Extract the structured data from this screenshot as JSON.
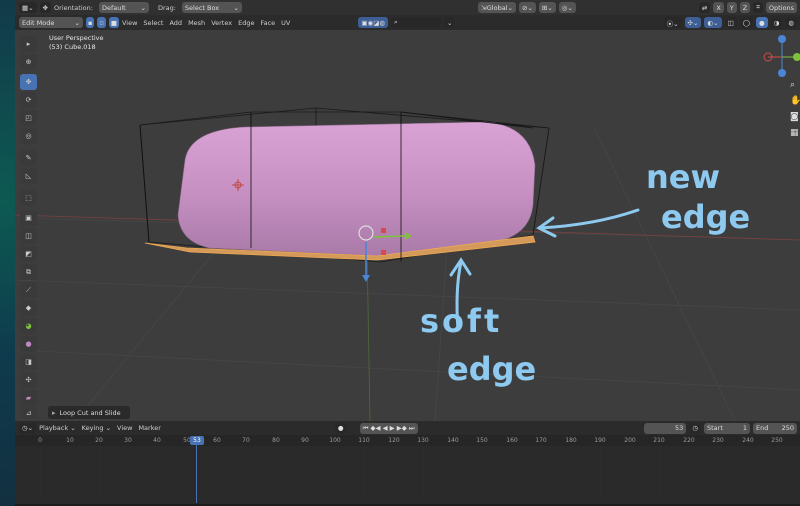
{
  "header": {
    "orientation_label": "Orientation:",
    "orientation_value": "Default",
    "drag_label": "Drag:",
    "drag_value": "Select Box",
    "transform_space": "Global",
    "options_label": "Options"
  },
  "menu": {
    "mode": "Edit Mode",
    "items": [
      "View",
      "Select",
      "Add",
      "Mesh",
      "Vertex",
      "Edge",
      "Face",
      "UV"
    ]
  },
  "viewport": {
    "perspective": "User Perspective",
    "object_name": "(53) Cube.018",
    "operator_panel": "Loop Cut and Slide"
  },
  "annotations": {
    "new_edge_line1": "new",
    "new_edge_line2": "edge",
    "soft_edge_line1": "soft",
    "soft_edge_line2": "edge"
  },
  "timeline": {
    "menus": [
      "Playback",
      "Keying",
      "View",
      "Marker"
    ],
    "current_frame": "53",
    "start_label": "Start",
    "start_value": "1",
    "end_label": "End",
    "end_value": "250",
    "ticks": [
      "0",
      "10",
      "20",
      "30",
      "40",
      "50",
      "53",
      "60",
      "70",
      "80",
      "90",
      "100",
      "110",
      "120",
      "130",
      "140",
      "150",
      "160",
      "170",
      "180",
      "190",
      "200",
      "210",
      "220",
      "230",
      "240",
      "250"
    ]
  },
  "axis_labels": {
    "x": "X",
    "y": "Y",
    "z": "Z"
  },
  "colors": {
    "accent": "#4772b3",
    "mesh": "#c08ac0",
    "annotation": "#8ec9f0",
    "frame_marker": "#4772b3"
  }
}
